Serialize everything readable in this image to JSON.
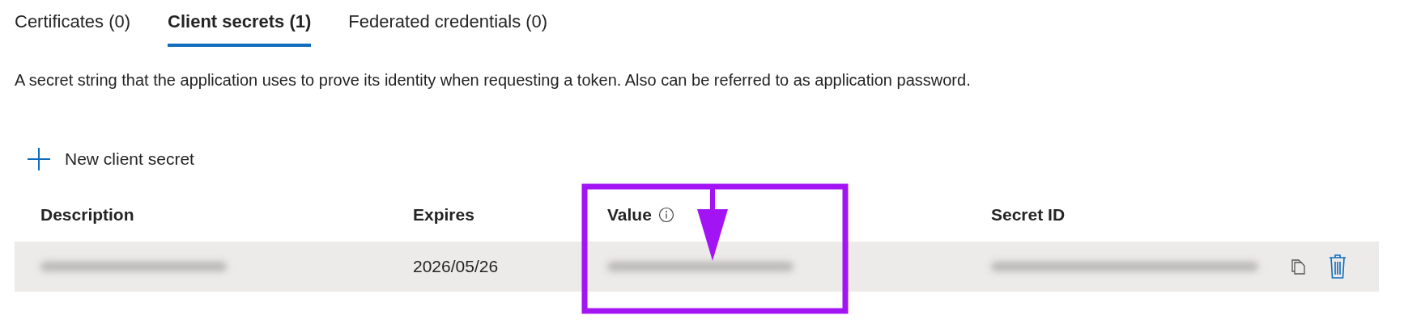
{
  "tabs": [
    {
      "label": "Certificates (0)",
      "selected": false
    },
    {
      "label": "Client secrets (1)",
      "selected": true
    },
    {
      "label": "Federated credentials (0)",
      "selected": false
    }
  ],
  "description": "A secret string that the application uses to prove its identity when requesting a token. Also can be referred to as application password.",
  "new_button": {
    "label": "New client secret"
  },
  "table": {
    "columns": [
      {
        "label": "Description",
        "info": false
      },
      {
        "label": "Expires",
        "info": false
      },
      {
        "label": "Value",
        "info": true
      },
      {
        "label": "Secret ID",
        "info": false
      }
    ],
    "rows": [
      {
        "cells": [
          {
            "kind": "redacted"
          },
          {
            "kind": "text",
            "text": "2026/05/26"
          },
          {
            "kind": "redacted"
          },
          {
            "kind": "redacted"
          }
        ]
      }
    ]
  }
}
